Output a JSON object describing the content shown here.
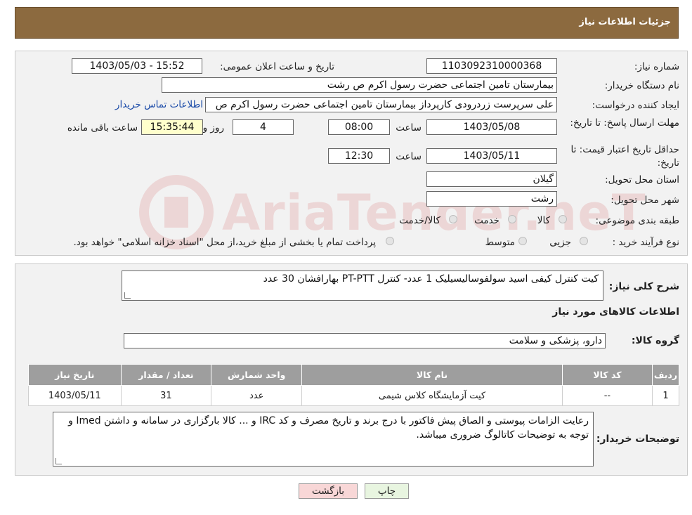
{
  "header": {
    "title": "جزئیات اطلاعات نیاز"
  },
  "form": {
    "need_number_label": "شماره نیاز:",
    "need_number": "1103092310000368",
    "announce_label": "تاریخ و ساعت اعلان عمومی:",
    "announce_value": "1403/05/03 - 15:52",
    "buyer_org_label": "نام دستگاه خریدار:",
    "buyer_org": "بیمارستان  تامین اجتماعی حضرت رسول اکرم ص رشت",
    "creator_label": "ایجاد کننده درخواست:",
    "creator": "علی سرپرست زردرودی کارپرداز بیمارستان  تامین اجتماعی حضرت رسول اکرم ص",
    "contact_link": "اطلاعات تماس خریدار",
    "deadline_label": "مهلت ارسال پاسخ: تا تاریخ:",
    "deadline_date": "1403/05/08",
    "time_label": "ساعت",
    "deadline_time": "08:00",
    "days_value": "4",
    "days_label": "روز و",
    "remaining_time": "15:35:44",
    "remaining_label": "ساعت باقی مانده",
    "validity_label": "حداقل تاریخ اعتبار قیمت: تا تاریخ:",
    "validity_date": "1403/05/11",
    "validity_time": "12:30",
    "province_label": "استان محل تحویل:",
    "province": "گیلان",
    "city_label": "شهر محل تحویل:",
    "city": "رشت",
    "category_label": "طبقه بندی موضوعی:",
    "category_options": [
      "کالا",
      "خدمت",
      "کالا/خدمت"
    ],
    "process_label": "نوع فرآیند خرید :",
    "process_options": [
      "جزیی",
      "متوسط"
    ],
    "process_note": "پرداخت تمام یا بخشی از مبلغ خرید،از محل \"اسناد خزانه اسلامی\" خواهد بود."
  },
  "details": {
    "description_label": "شرح کلی نیاز:",
    "description": "کیت کنترل کیفی اسید سولفوسالیسیلیک 1 عدد- کنترل PT-PTT بهارافشان 30 عدد",
    "items_heading": "اطلاعات کالاهای مورد نیاز",
    "group_label": "گروه کالا:",
    "group_value": "دارو، پزشکی و سلامت",
    "table": {
      "headers": [
        "ردیف",
        "کد کالا",
        "نام کالا",
        "واحد شمارش",
        "تعداد / مقدار",
        "تاریخ نیاز"
      ],
      "rows": [
        [
          "1",
          "--",
          "کیت آزمایشگاه کلاس شیمی",
          "عدد",
          "31",
          "1403/05/11"
        ]
      ]
    },
    "buyer_notes_label": "توضیحات خریدار:",
    "buyer_notes": "رعایت الزامات پیوستی و الصاق پیش فاکتور با درج برند و تاریخ مصرف و کد IRC و ... کالا بارگزاری در سامانه و داشتن Imed و توجه به توضیحات کاتالوگ ضروری میباشد."
  },
  "buttons": {
    "print": "چاپ",
    "back": "بازگشت"
  },
  "watermark": {
    "text": "AriaTender.neT"
  },
  "colors": {
    "header": "#8c6a3f",
    "link": "#1a4aa8",
    "back_button": "#f8d7d7",
    "print_button": "#e8f5e0",
    "highlight": "#ffffcc"
  }
}
